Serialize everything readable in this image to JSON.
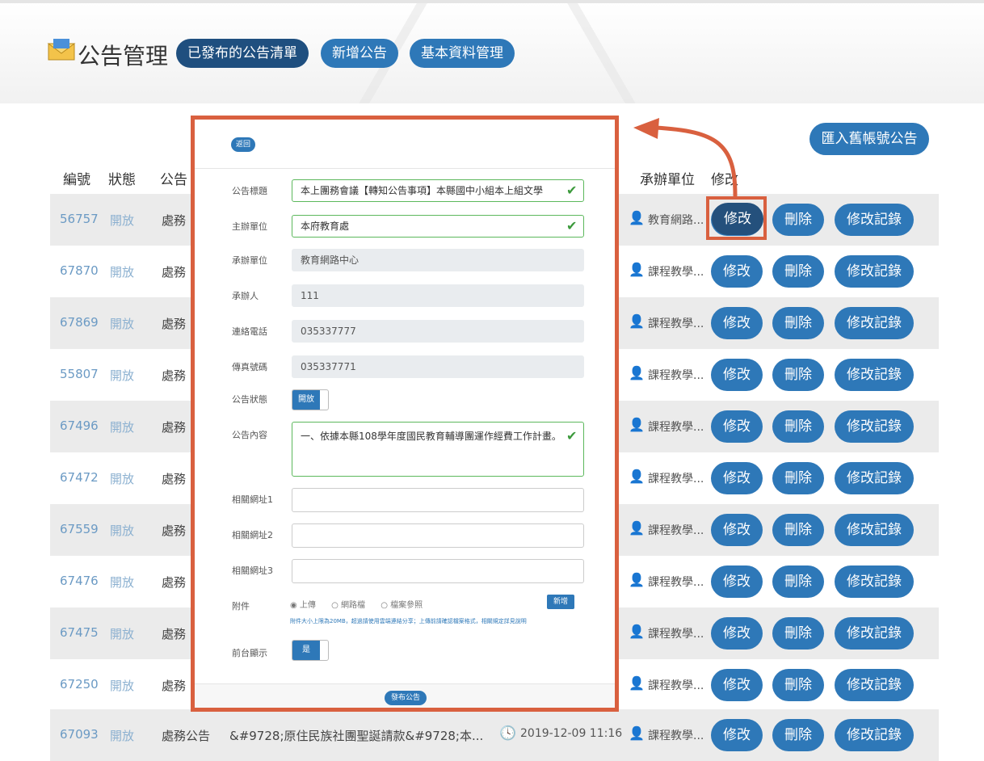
{
  "header": {
    "title": "公告管理",
    "nav": [
      {
        "label": "已發布的公告清單",
        "active": true
      },
      {
        "label": "新增公告",
        "active": false
      },
      {
        "label": "基本資料管理",
        "active": false
      }
    ],
    "logo_icon": "envelope-icon"
  },
  "toolbar": {
    "import_label": "匯入舊帳號公告"
  },
  "table": {
    "headers": {
      "id": "編號",
      "status": "狀態",
      "type": "公告",
      "unit": "承辦單位",
      "edit": "修改"
    },
    "rows": [
      {
        "id": "56757",
        "status": "開放",
        "type": "處務",
        "unit": "教育網路...",
        "edit": "修改",
        "delete": "刪除",
        "log": "修改記錄"
      },
      {
        "id": "67870",
        "status": "開放",
        "type": "處務",
        "unit": "課程教學...",
        "edit": "修改",
        "delete": "刪除",
        "log": "修改記錄"
      },
      {
        "id": "67869",
        "status": "開放",
        "type": "處務",
        "unit": "課程教學...",
        "edit": "修改",
        "delete": "刪除",
        "log": "修改記錄"
      },
      {
        "id": "55807",
        "status": "開放",
        "type": "處務",
        "unit": "課程教學...",
        "edit": "修改",
        "delete": "刪除",
        "log": "修改記錄"
      },
      {
        "id": "67496",
        "status": "開放",
        "type": "處務",
        "unit": "課程教學...",
        "edit": "修改",
        "delete": "刪除",
        "log": "修改記錄"
      },
      {
        "id": "67472",
        "status": "開放",
        "type": "處務",
        "unit": "課程教學...",
        "edit": "修改",
        "delete": "刪除",
        "log": "修改記錄"
      },
      {
        "id": "67559",
        "status": "開放",
        "type": "處務",
        "unit": "課程教學...",
        "edit": "修改",
        "delete": "刪除",
        "log": "修改記錄"
      },
      {
        "id": "67476",
        "status": "開放",
        "type": "處務",
        "unit": "課程教學...",
        "edit": "修改",
        "delete": "刪除",
        "log": "修改記錄"
      },
      {
        "id": "67475",
        "status": "開放",
        "type": "處務",
        "unit": "課程教學...",
        "edit": "修改",
        "delete": "刪除",
        "log": "修改記錄"
      },
      {
        "id": "67250",
        "status": "開放",
        "type": "處務",
        "unit": "課程教學...",
        "edit": "修改",
        "delete": "刪除",
        "log": "修改記錄"
      },
      {
        "id": "67093",
        "status": "開放",
        "type": "處務公告",
        "title": "&#9728;原住民族社團聖誕請款&#9728;本...",
        "date": "2019-12-09 11:16",
        "unit": "課程教學...",
        "edit": "修改",
        "delete": "刪除",
        "log": "修改記錄"
      }
    ]
  },
  "modal": {
    "back_label": "返回",
    "fields": {
      "title_label": "公告標題",
      "title_value": "本上團務會議【轉知公告事項】本縣國中小組本上組文學",
      "host_label": "主辦單位",
      "host_value": "本府教育處",
      "undertaker_label": "承辦單位",
      "undertaker_value": "教育網路中心",
      "contact_label": "承辦人",
      "contact_value": "111",
      "phone_label": "連絡電話",
      "phone_value": "035337777",
      "fax_label": "傳真號碼",
      "fax_value": "035337771",
      "status_label": "公告狀態",
      "status_toggle": "開放",
      "content_label": "公告內容",
      "content_value": "一、依據本縣108學年度國民教育輔導團運作經費工作計畫。",
      "link1_label": "相關網址1",
      "link2_label": "相關網址2",
      "link3_label": "相關網址3",
      "attach_label": "附件",
      "attach_options": [
        "上傳",
        "網路檔",
        "檔案參照"
      ],
      "attach_add": "新增",
      "attach_hint": "附件大小上限為20MB，超過請使用雲端連結分享；上傳前請確認檔案格式，相關規定詳見說明",
      "front_label": "前台顯示",
      "front_toggle": "是"
    },
    "submit_label": "發布公告"
  },
  "colors": {
    "accent": "#2e78b8",
    "highlight": "#d9603f",
    "success": "#5cb85c"
  }
}
